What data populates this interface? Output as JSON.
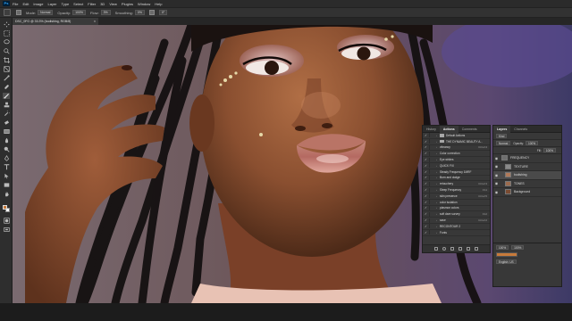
{
  "app": {
    "logo_text": "Ps",
    "menu": [
      "File",
      "Edit",
      "Image",
      "Layer",
      "Type",
      "Select",
      "Filter",
      "3D",
      "View",
      "Plugins",
      "Window",
      "Help"
    ]
  },
  "options": {
    "mode_label": "Mode:",
    "mode_value": "Normal",
    "opacity_label": "Opacity:",
    "opacity_value": "100%",
    "flow_label": "Flow:",
    "flow_value": "3%",
    "smoothing_label": "Smoothing:",
    "smoothing_value": "0%",
    "angle_value": "0°"
  },
  "document": {
    "tab_title": "DSC_0FG @ 33.3% (bodishing, RGB/8)",
    "close_glyph": "×"
  },
  "actions_panel": {
    "tabs": [
      "History",
      "Actions",
      "Comments"
    ],
    "rows": [
      {
        "name": "Default Actions",
        "key": "",
        "type": "folder"
      },
      {
        "name": "THE DYNAMIC BEAUTY A...",
        "key": "",
        "type": "folder"
      },
      {
        "name": "vibrancy",
        "key": "Ctrl+F4",
        "type": "action"
      },
      {
        "name": "Color correction",
        "key": "",
        "type": "action"
      },
      {
        "name": "Eye whites",
        "key": "",
        "type": "action"
      },
      {
        "name": "QUICK FIX",
        "key": "",
        "type": "action"
      },
      {
        "name": "Steady Frequency 1MRF",
        "key": "",
        "type": "action"
      },
      {
        "name": "Burn and dodge",
        "key": "",
        "type": "action"
      },
      {
        "name": "retouchery",
        "key": "Ctrl+F3",
        "type": "action"
      },
      {
        "name": "Sleep Frequency",
        "key": "F11",
        "type": "action"
      },
      {
        "name": "skin presence",
        "key": "Ctrl+F5",
        "type": "action"
      },
      {
        "name": "color isolation",
        "key": "",
        "type": "action"
      },
      {
        "name": "plasmon colors",
        "key": "",
        "type": "action"
      },
      {
        "name": "soft dare survey",
        "key": "F12",
        "type": "action"
      },
      {
        "name": "save",
        "key": "Ctrl+F2",
        "type": "action"
      },
      {
        "name": "RECONTOUR 2",
        "key": "",
        "type": "action"
      },
      {
        "name": "Fonts",
        "key": "",
        "type": "action"
      }
    ]
  },
  "layers_panel": {
    "tabs": [
      "Layers",
      "Channels"
    ],
    "filter_label": "Kind",
    "blend_value": "Normal",
    "opacity_label": "Opacity:",
    "opacity_value": "100%",
    "fill_label": "Fill:",
    "fill_value": "100%",
    "layers": [
      {
        "name": "FREQUENCY",
        "type": "group",
        "selected": false,
        "thumb": "#6e6e6e"
      },
      {
        "name": "TEXTURE",
        "type": "layer",
        "selected": false,
        "thumb": "#8a8a8a"
      },
      {
        "name": "bodishing",
        "type": "layer",
        "selected": true,
        "thumb": "#b07a5a"
      },
      {
        "name": "TONES",
        "type": "layer",
        "selected": false,
        "thumb": "#9c6b4e"
      },
      {
        "name": "Background",
        "type": "layer",
        "selected": false,
        "thumb": "#7a4b32"
      }
    ]
  },
  "properties": {
    "width_value": "100%",
    "height_value": "100%",
    "unit_label": "English: US"
  },
  "colors": {
    "foreground": "#c77a3a",
    "background": "#ffffff",
    "skin": "#8a4f30",
    "photo_bg": "#6d5a5e"
  }
}
